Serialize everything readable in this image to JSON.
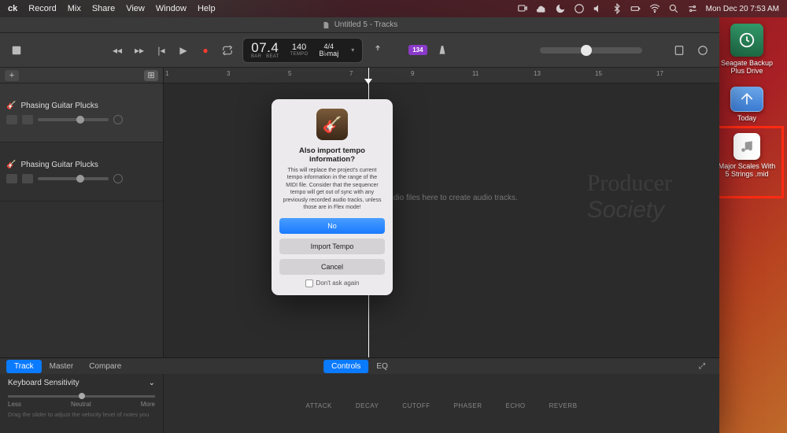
{
  "menubar": {
    "app": "ck",
    "items": [
      "Record",
      "Mix",
      "Share",
      "View",
      "Window",
      "Help"
    ],
    "clock": "Mon Dec 20  7:53 AM"
  },
  "desktop": {
    "drive_label": "Seagate Backup Plus Drive",
    "folder_label": "Today",
    "midi_label": "Major Scales With 5 Strings .mid"
  },
  "window": {
    "title": "Untitled 5 - Tracks"
  },
  "lcd": {
    "bar": "0",
    "beat": "7.4",
    "bar_label": "BAR",
    "beat_label": "BEAT",
    "tempo": "140",
    "tempo_label": "TEMPO",
    "sig": "4/4",
    "key": "B♭maj"
  },
  "badge": "134",
  "tracks": [
    {
      "name": "Phasing Guitar Plucks"
    },
    {
      "name": "Phasing Guitar Plucks"
    }
  ],
  "ruler": [
    "1",
    "3",
    "5",
    "7",
    "9",
    "11",
    "13",
    "15",
    "17"
  ],
  "drop_hint": "Drag audio files here to create audio tracks.",
  "bottom_tabs": {
    "track": "Track",
    "master": "Master",
    "compare": "Compare",
    "controls": "Controls",
    "eq": "EQ"
  },
  "inspector": {
    "title": "Keyboard Sensitivity",
    "less": "Less",
    "neutral": "Neutral",
    "more": "More",
    "desc": "Drag the slider to adjust the velocity level of notes you"
  },
  "smart": [
    "ATTACK",
    "DECAY",
    "CUTOFF",
    "PHASER",
    "ECHO",
    "REVERB"
  ],
  "dialog": {
    "title": "Also import tempo information?",
    "body": "This will replace the project's current tempo information in the range of the MIDI file. Consider that the sequencer tempo will get out of sync with any previously recorded audio tracks, unless those are in Flex mode!",
    "no": "No",
    "import": "Import Tempo",
    "cancel": "Cancel",
    "dont_ask": "Don't ask again"
  }
}
